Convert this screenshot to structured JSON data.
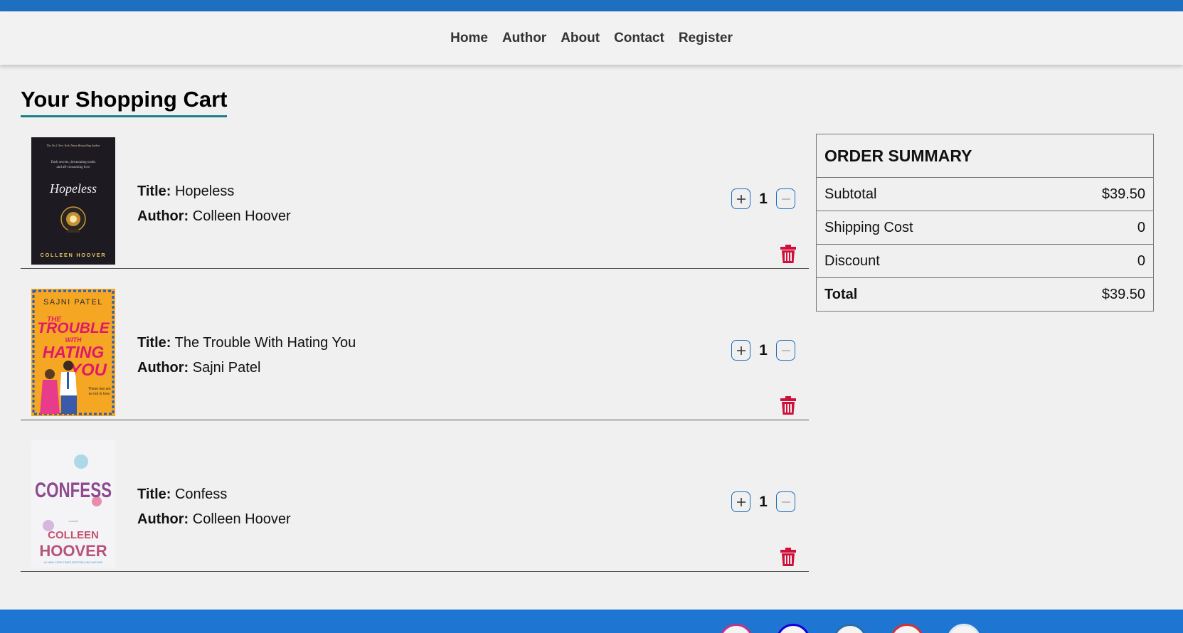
{
  "nav": {
    "links": [
      "Home",
      "Author",
      "About",
      "Contact",
      "Register"
    ]
  },
  "page": {
    "title": "Your Shopping Cart"
  },
  "labels": {
    "title": "Title:",
    "author": "Author:"
  },
  "cart": {
    "items": [
      {
        "title": "Hopeless",
        "author": "Colleen Hoover",
        "qty": "1"
      },
      {
        "title": "The Trouble With Hating You",
        "author": "Sajni Patel",
        "qty": "1"
      },
      {
        "title": "Confess",
        "author": "Colleen Hoover",
        "qty": "1"
      }
    ]
  },
  "covers": {
    "hopeless": {
      "top": "The No.1 New York Times Bestselling Author",
      "blurb1": "Dark secrets, devastating truths",
      "blurb2": "and all-consuming love",
      "name": "Hopeless",
      "author": "COLLEEN HOOVER"
    },
    "trouble": {
      "author": "SAJNI PATEL",
      "w1": "THE",
      "w2": "TROUBLE",
      "w3": "WITH",
      "w4": "HATING",
      "w5": "YOU",
      "tag1": "These two are",
      "tag2": "so not in love."
    },
    "confess": {
      "name": "CONFESS",
      "kicker": "a novel",
      "a1": "COLLEEN",
      "a2": "HOOVER",
      "bottom": "#1 NEW YORK TIMES BESTSELLING AUTHOR"
    }
  },
  "summary": {
    "heading": "ORDER SUMMARY",
    "rows": [
      {
        "label": "Subtotal",
        "value": "$39.50"
      },
      {
        "label": "Shipping Cost",
        "value": "0"
      },
      {
        "label": "Discount",
        "value": "0"
      },
      {
        "label": "Total",
        "value": "$39.50"
      }
    ]
  },
  "icons": {
    "plus": "plus-icon",
    "minus": "minus-icon",
    "trash": "trash-icon",
    "social": [
      "instagram-icon",
      "facebook-icon",
      "linkedin-icon",
      "youtube-icon",
      "twitter-icon"
    ]
  },
  "colors": {
    "brand_blue": "#1e6fbf",
    "footer_blue": "#1e76d2",
    "title_underline": "#1b7f86",
    "trash_red": "#d0103a",
    "page_bg": "#f0f0f0"
  }
}
